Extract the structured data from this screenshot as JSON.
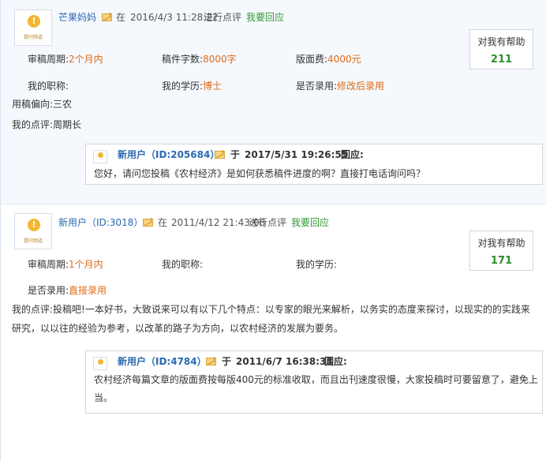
{
  "entries": [
    {
      "avatar_text": "提问频道",
      "user": "芒果妈妈",
      "at": "在",
      "time": "2016/4/3 11:28:22",
      "action": "进行点评",
      "reply_link": "我要回应",
      "help_label": "对我有帮助",
      "help_count": "211",
      "fields": {
        "review_period_label": "审稿周期:",
        "review_period": "2个月内",
        "word_count_label": "稿件字数:",
        "word_count": "8000字",
        "layout_fee_label": "版面费:",
        "layout_fee": "4000元",
        "title_label": "我的职称:",
        "title": "",
        "education_label": "我的学历:",
        "education": "博士",
        "accepted_label": "是否录用:",
        "accepted": "修改后录用",
        "bias_label": "用稿偏向:",
        "bias": "三农",
        "comment_label": "我的点评:",
        "comment": "周期长"
      },
      "response": {
        "user": "新用户（ID:205684）",
        "yu": "于",
        "time": "2017/5/31 19:26:55",
        "reply_label": "回应:",
        "text": "您好，请问您投稿《农村经济》是如何获悉稿件进度的啊？直接打电话询问吗？"
      }
    },
    {
      "avatar_text": "提问频道",
      "user": "新用户（ID:3018）",
      "at": "在",
      "time": "2011/4/12 21:43:08",
      "action": "进行点评",
      "reply_link": "我要回应",
      "help_label": "对我有帮助",
      "help_count": "171",
      "fields": {
        "review_period_label": "审稿周期:",
        "review_period": "1个月内",
        "title_label": "我的职称:",
        "education_label": "我的学历:",
        "accepted_label": "是否录用:",
        "accepted": "直接录用",
        "comment_label": "我的点评:",
        "comment_line1": "投稿吧!一本好书，大致说来可以有以下几个特点：以专家的眼光来解析，以务实的态度来探讨，以现实的的实践来",
        "comment_line2": "研究，以以往的经验为参考，以改革的路子为方向，以农村经济的发展为要务。"
      },
      "response": {
        "user": "新用户（ID:4784）",
        "yu": "于",
        "time": "2011/6/7 16:38:33",
        "reply_label": "回应:",
        "text_line1": "农村经济每篇文章的版面费按每版400元的标准收取，而且出刊速度很慢，大家投稿时可要留意了，避免上",
        "text_line2": "当。"
      }
    }
  ],
  "colors": {
    "user_link": "#2a6ab3",
    "reply_link": "#339933",
    "field_value": "#e06b15",
    "help_count": "#2f8f2f"
  }
}
